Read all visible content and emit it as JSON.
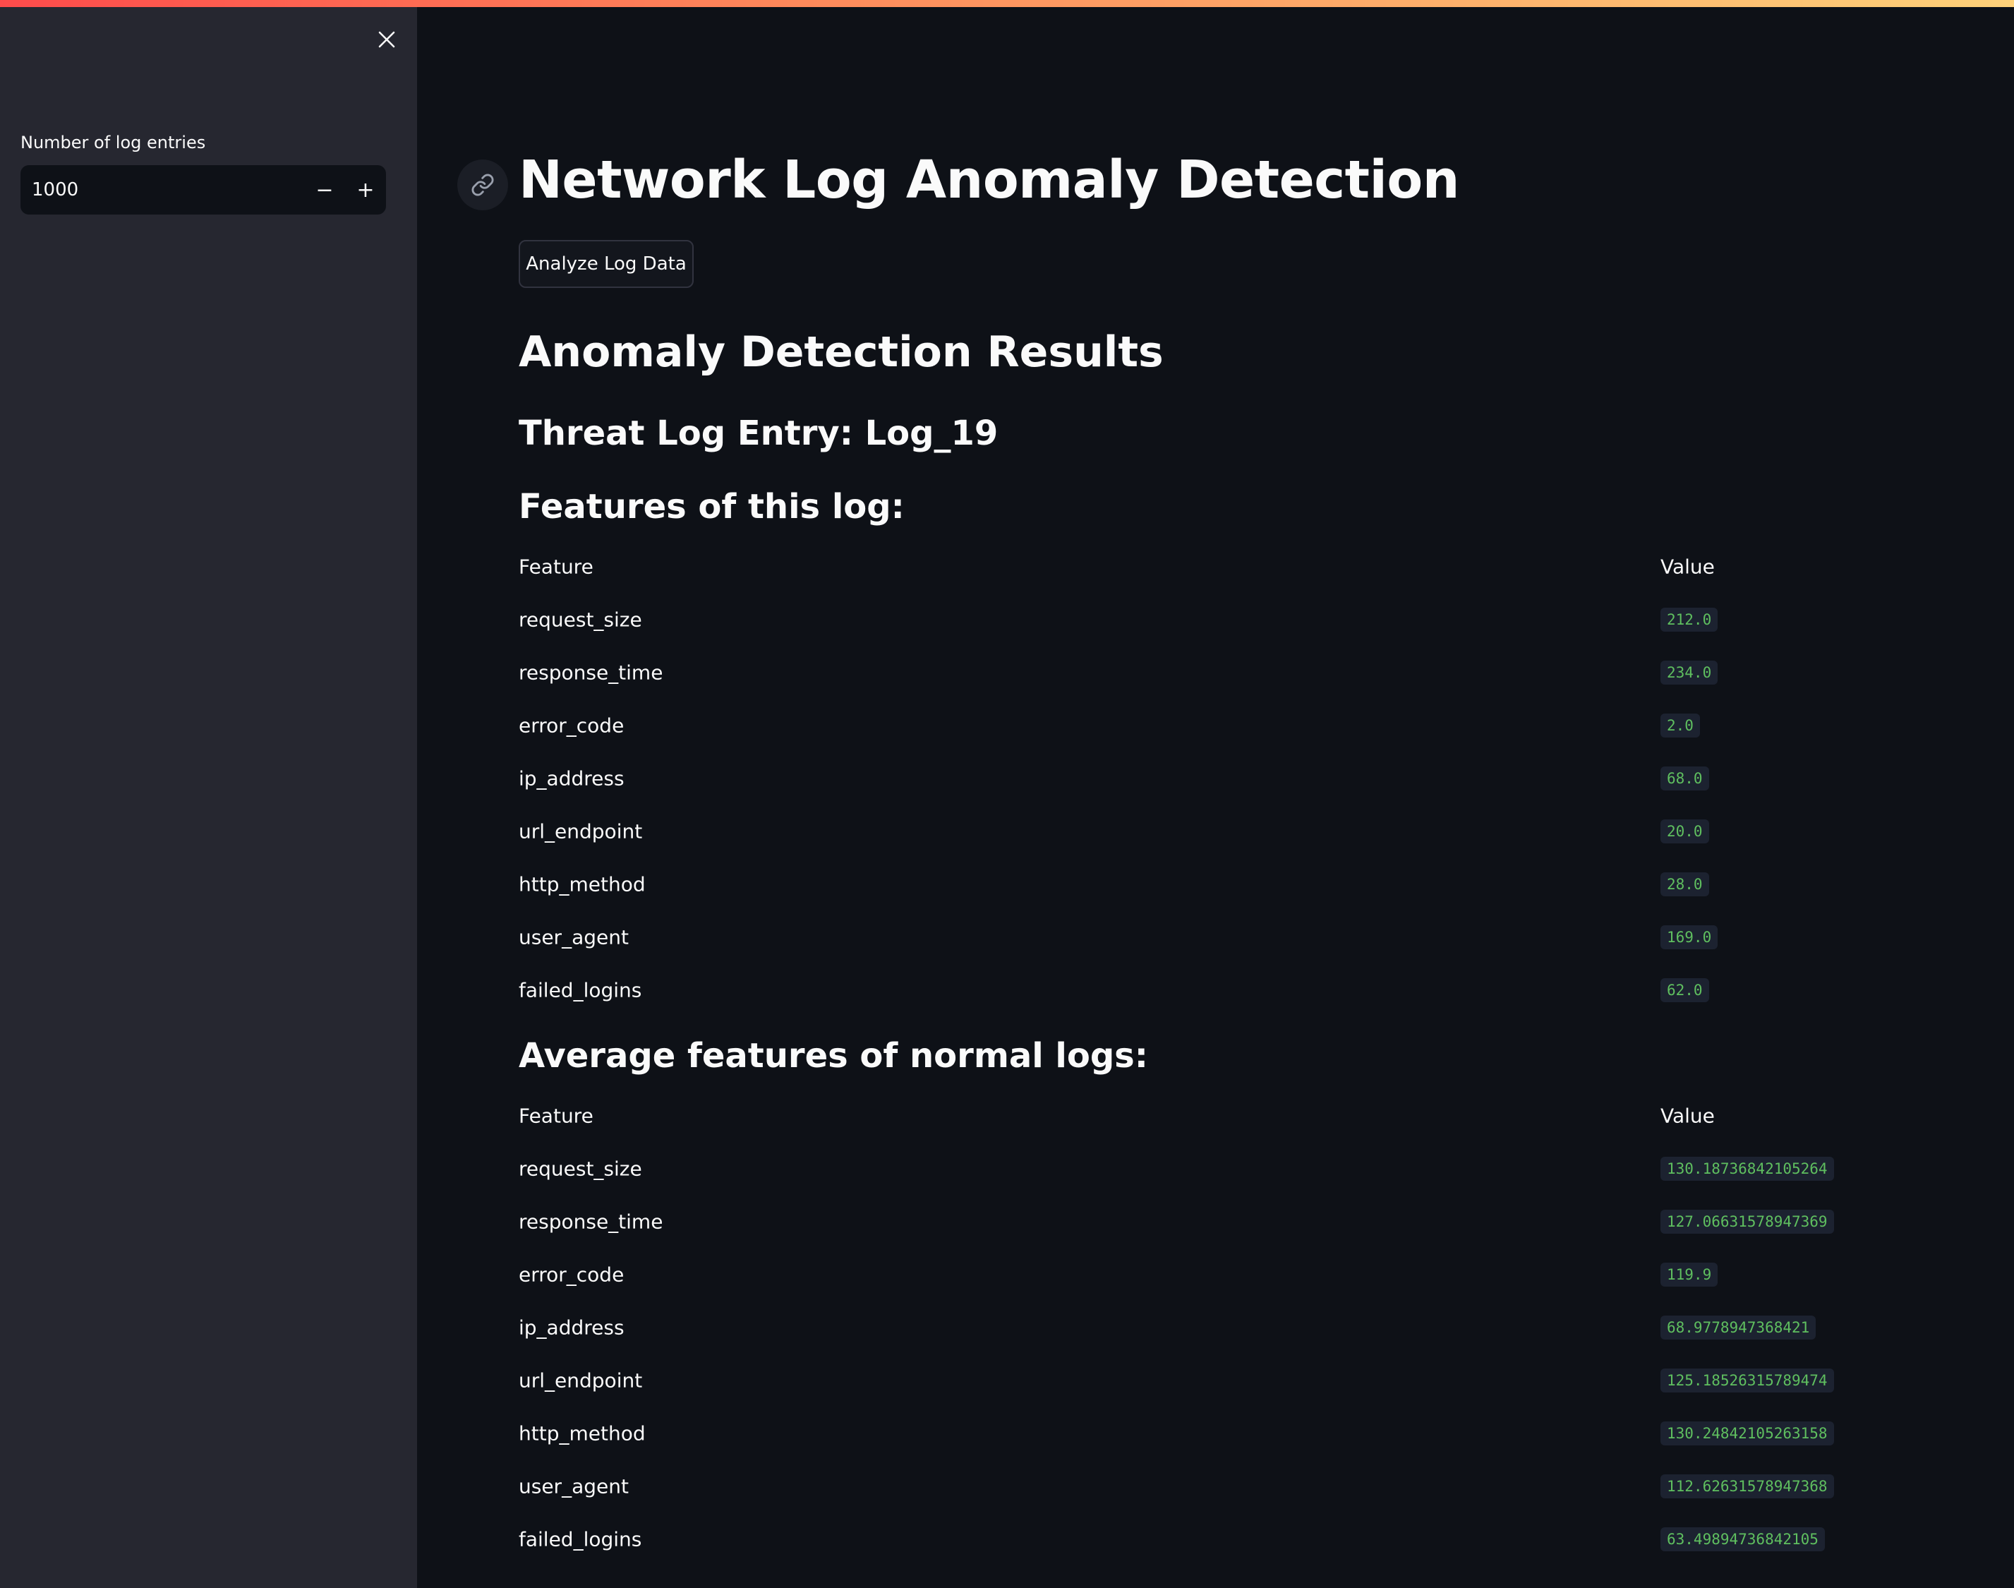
{
  "sidebar": {
    "close_icon": "close-icon",
    "number_input": {
      "label": "Number of log entries",
      "value": "1000",
      "decrement_label": "−",
      "increment_label": "+"
    }
  },
  "main": {
    "title": "Network Log Anomaly Detection",
    "anchor_icon": "link-icon",
    "analyze_button": "Analyze Log Data",
    "results_heading": "Anomaly Detection Results",
    "threat_heading": "Threat Log Entry: Log_19",
    "features_heading": "Features of this log:",
    "average_heading": "Average features of normal logs:",
    "table_headers": {
      "feature": "Feature",
      "value": "Value"
    },
    "threat_features": [
      {
        "feature": "request_size",
        "value": "212.0"
      },
      {
        "feature": "response_time",
        "value": "234.0"
      },
      {
        "feature": "error_code",
        "value": "2.0"
      },
      {
        "feature": "ip_address",
        "value": "68.0"
      },
      {
        "feature": "url_endpoint",
        "value": "20.0"
      },
      {
        "feature": "http_method",
        "value": "28.0"
      },
      {
        "feature": "user_agent",
        "value": "169.0"
      },
      {
        "feature": "failed_logins",
        "value": "62.0"
      }
    ],
    "normal_features": [
      {
        "feature": "request_size",
        "value": "130.18736842105264"
      },
      {
        "feature": "response_time",
        "value": "127.06631578947369"
      },
      {
        "feature": "error_code",
        "value": "119.9"
      },
      {
        "feature": "ip_address",
        "value": "68.9778947368421"
      },
      {
        "feature": "url_endpoint",
        "value": "125.18526315789474"
      },
      {
        "feature": "http_method",
        "value": "130.24842105263158"
      },
      {
        "feature": "user_agent",
        "value": "112.62631578947368"
      },
      {
        "feature": "failed_logins",
        "value": "63.49894736842105"
      }
    ],
    "value_color": "#5fbf5f"
  },
  "theme": {
    "background": "#0e1117",
    "sidebar_background": "#262730",
    "text": "#fafafa",
    "accent_gradient_start": "#ff4b4b",
    "accent_gradient_end": "#ffd27a"
  }
}
